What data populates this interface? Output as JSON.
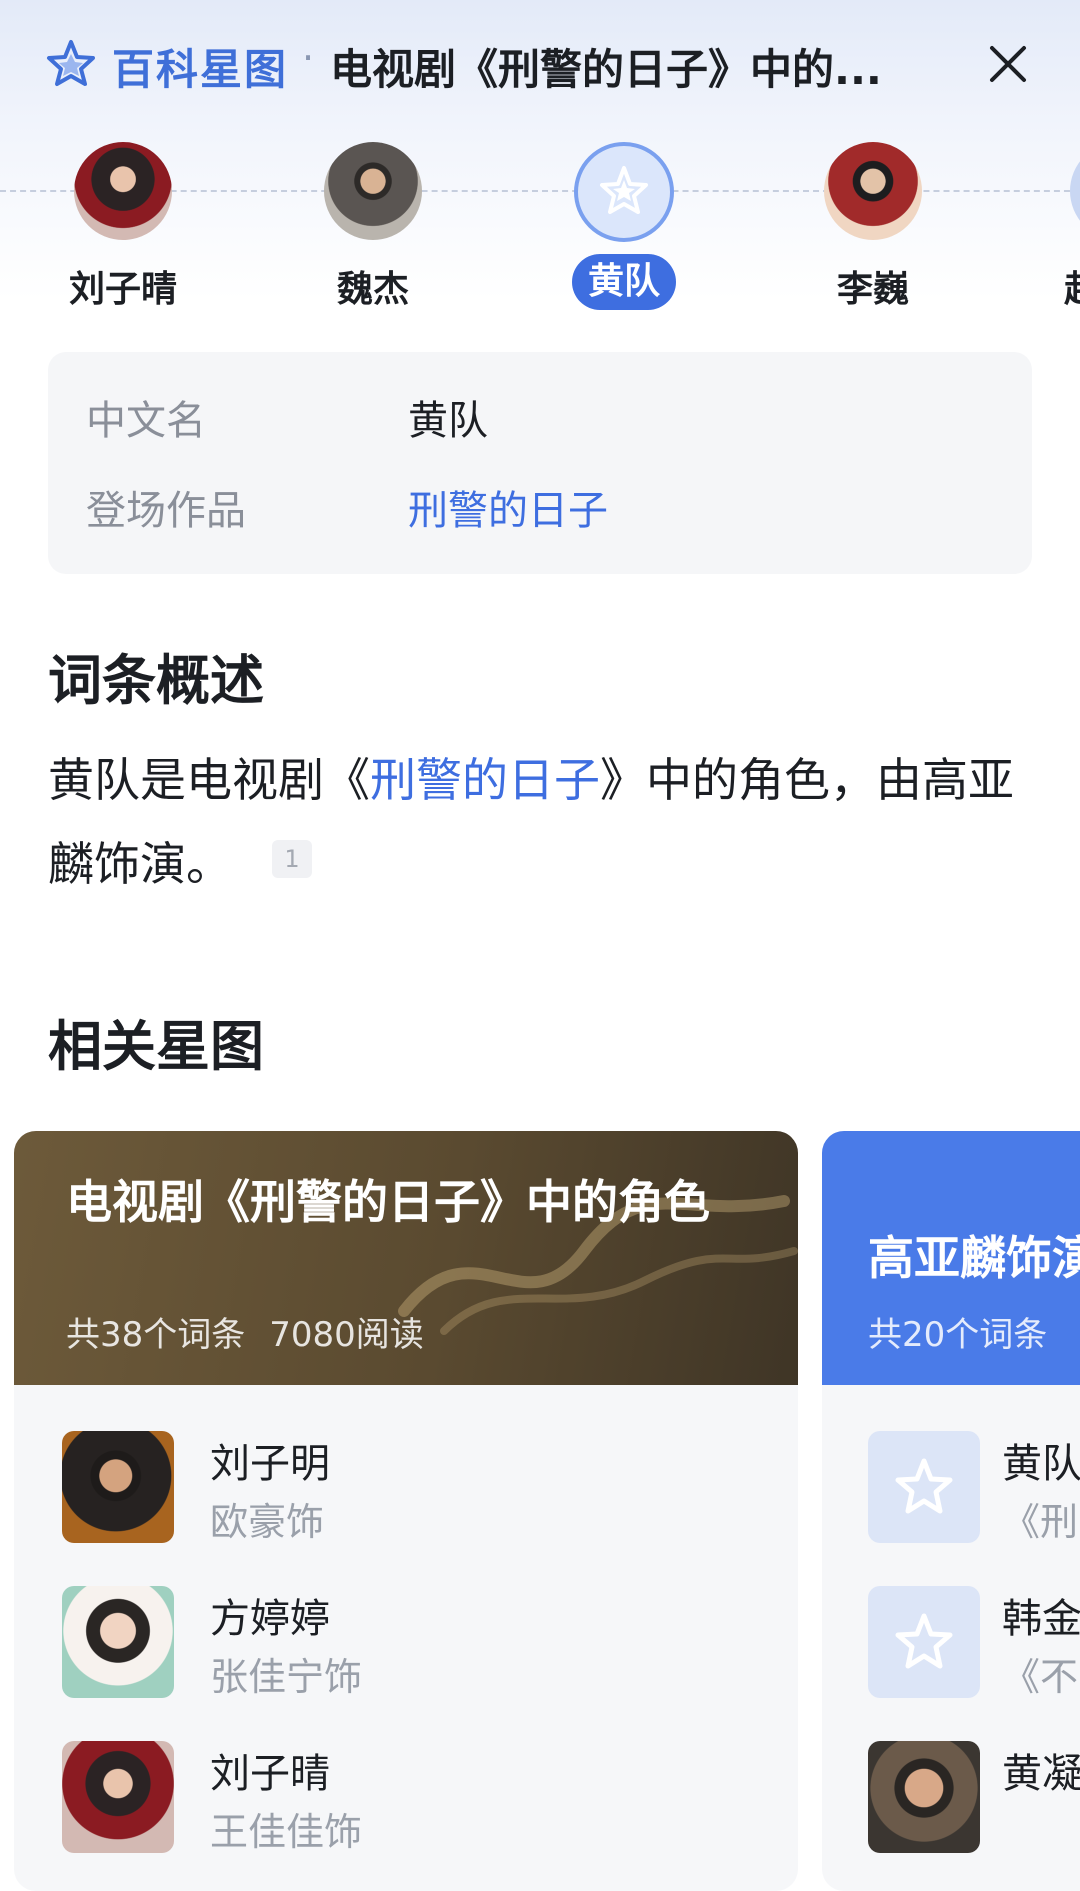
{
  "header": {
    "brand": "百科星图",
    "separator": "·",
    "title": "电视剧《刑警的日子》中的..."
  },
  "people": [
    {
      "name": "刘子晴",
      "avatar": "woman-red-scarf-photo"
    },
    {
      "name": "魏杰",
      "avatar": "man-photo"
    },
    {
      "name": "黄队",
      "avatar": "star-icon",
      "active": true
    },
    {
      "name": "李巍",
      "avatar": "man-red-background-photo"
    },
    {
      "name": "赴",
      "avatar": "partial"
    }
  ],
  "info": {
    "rows": [
      {
        "label": "中文名",
        "value": "黄队"
      },
      {
        "label": "登场作品",
        "value": "刑警的日子"
      }
    ]
  },
  "overview": {
    "title": "词条概述",
    "text_before": "黄队是电视剧《",
    "link": "刑警的日子",
    "text_after": "》中的角色，由高亚麟饰演。",
    "ref": "1"
  },
  "related": {
    "title": "相关星图",
    "cards": [
      {
        "title": "电视剧《刑警的日子》中的角色",
        "entries": "共38个词条",
        "reads": "7080阅读",
        "items": [
          {
            "name": "刘子明",
            "sub": "欧豪饰"
          },
          {
            "name": "方婷婷",
            "sub": "张佳宁饰"
          },
          {
            "name": "刘子晴",
            "sub": "王佳佳饰"
          }
        ]
      },
      {
        "title": "高亚麟饰演",
        "entries": "共20个词条",
        "reads": "",
        "items": [
          {
            "name": "黄队",
            "sub": "《刑"
          },
          {
            "name": "韩金",
            "sub": "《不"
          },
          {
            "name": "黄凝",
            "sub": ""
          }
        ]
      }
    ]
  },
  "colors": {
    "accent": "#3e6ee0",
    "card1_header": "#5a4a30",
    "card2_header": "#4a7be8"
  }
}
